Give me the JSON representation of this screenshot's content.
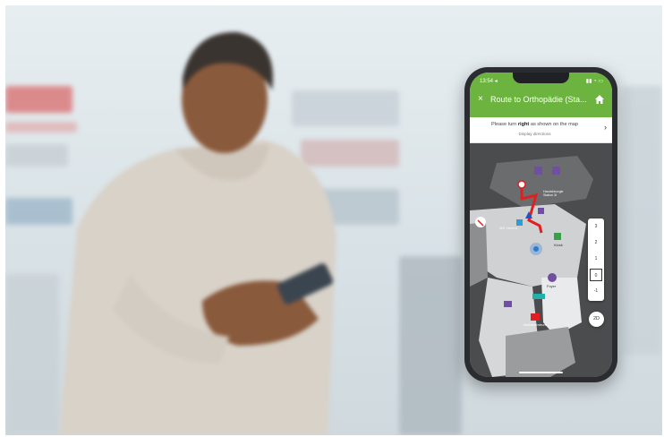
{
  "app": {
    "status_time": "13:54 ◂",
    "title": "Route to Orthopädie (Sta...",
    "instruction_prefix": "Please turn ",
    "instruction_bold": "right",
    "instruction_suffix": " as shown on the map",
    "instruction_sub": "Display directions",
    "floors": [
      "3",
      "2",
      "1",
      "0",
      "-1"
    ],
    "active_floor": "0",
    "view_toggle": "2D",
    "map_labels": {
      "haus": "Handchirurgie\nStation 3i",
      "wc": "WC Herren",
      "foyer": "Foyer",
      "kiosk": "Kiosk",
      "notfall": "Notfallzentrum"
    }
  },
  "colors": {
    "header": "#6cb33f",
    "route": "#e02020",
    "position": "#2b7bd6",
    "map_bg": "#4a4c4e"
  }
}
